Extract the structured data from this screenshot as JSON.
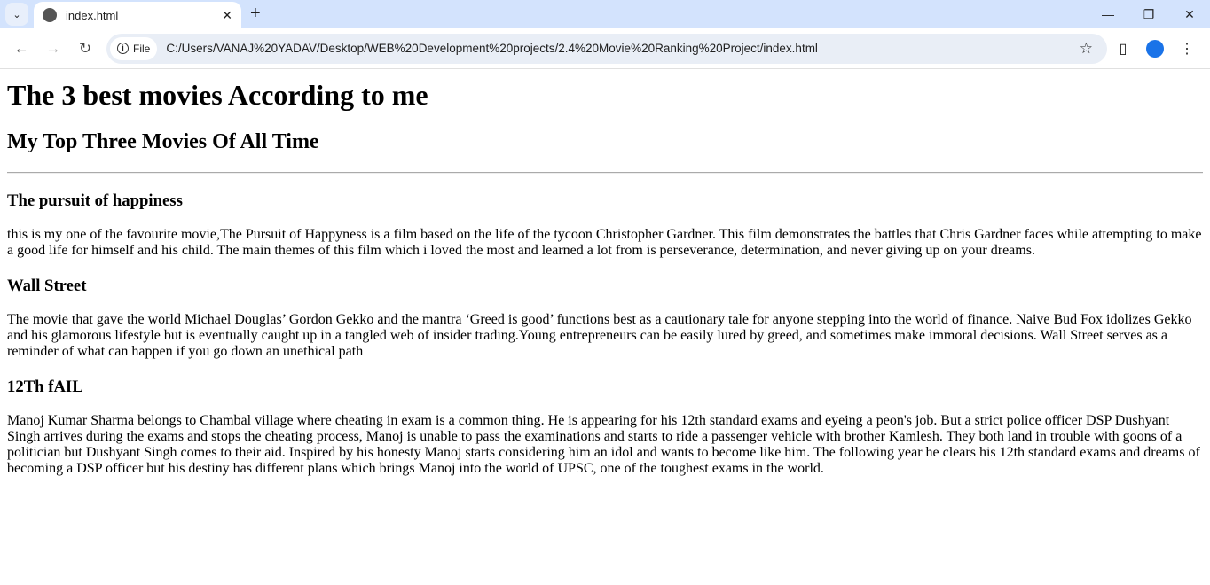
{
  "browser": {
    "tab_title": "index.html",
    "url_chip": "File",
    "url": "C:/Users/VANAJ%20YADAV/Desktop/WEB%20Development%20projects/2.4%20Movie%20Ranking%20Project/index.html"
  },
  "page": {
    "title": "The 3 best movies According to me",
    "subtitle": "My Top Three Movies Of All Time",
    "movies": [
      {
        "name": "The pursuit of happiness",
        "description": "this is my one of the favourite movie,The Pursuit of Happyness is a film based on the life of the tycoon Christopher Gardner. This film demonstrates the battles that Chris Gardner faces while attempting to make a good life for himself and his child. The main themes of this film which i loved the most and learned a lot from is perseverance, determination, and never giving up on your dreams."
      },
      {
        "name": "Wall Street",
        "description": "The movie that gave the world Michael Douglas’ Gordon Gekko and the mantra ‘Greed is good’ functions best as a cautionary tale for anyone stepping into the world of finance. Naive Bud Fox idolizes Gekko and his glamorous lifestyle but is eventually caught up in a tangled web of insider trading.Young entrepreneurs can be easily lured by greed, and sometimes make immoral decisions. Wall Street serves as a reminder of what can happen if you go down an unethical path"
      },
      {
        "name": "12Th fAIL",
        "description": "Manoj Kumar Sharma belongs to Chambal village where cheating in exam is a common thing. He is appearing for his 12th standard exams and eyeing a peon's job. But a strict police officer DSP Dushyant Singh arrives during the exams and stops the cheating process, Manoj is unable to pass the examinations and starts to ride a passenger vehicle with brother Kamlesh. They both land in trouble with goons of a politician but Dushyant Singh comes to their aid. Inspired by his honesty Manoj starts considering him an idol and wants to become like him. The following year he clears his 12th standard exams and dreams of becoming a DSP officer but his destiny has different plans which brings Manoj into the world of UPSC, one of the toughest exams in the world."
      }
    ]
  }
}
